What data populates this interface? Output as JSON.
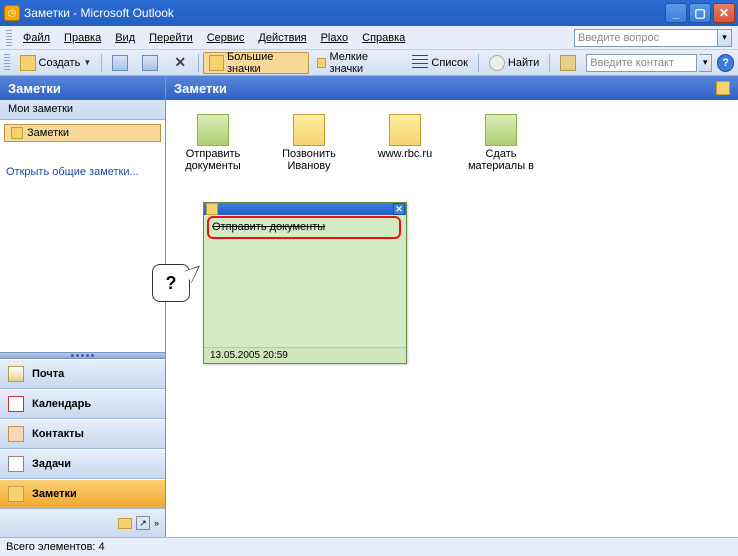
{
  "title": "Заметки - Microsoft Outlook",
  "menubar": {
    "file": "Файл",
    "edit": "Правка",
    "view": "Вид",
    "go": "Перейти",
    "service": "Сервис",
    "actions": "Действия",
    "plaxo": "Plaxo",
    "help": "Справка",
    "question_placeholder": "Введите вопрос"
  },
  "toolbar": {
    "create": "Создать",
    "large_icons": "Большие значки",
    "small_icons": "Мелкие значки",
    "list": "Список",
    "find": "Найти",
    "contact_placeholder": "Введите контакт"
  },
  "nav": {
    "header": "Заметки",
    "my_notes": "Мои заметки",
    "notes_folder": "Заметки",
    "open_shared": "Открыть общие заметки...",
    "mail": "Почта",
    "calendar": "Календарь",
    "contacts": "Контакты",
    "tasks": "Задачи",
    "notes": "Заметки"
  },
  "content": {
    "header": "Заметки",
    "items": [
      {
        "label": "Отправить документы",
        "color": "green"
      },
      {
        "label": "Позвонить Иванову",
        "color": "yellow"
      },
      {
        "label": "www.rbc.ru",
        "color": "yellow"
      },
      {
        "label": "Сдать материалы в",
        "color": "green"
      }
    ]
  },
  "sticky": {
    "text": "Отправить документы",
    "timestamp": "13.05.2005 20:59"
  },
  "callout": "?",
  "status": "Всего элементов: 4"
}
